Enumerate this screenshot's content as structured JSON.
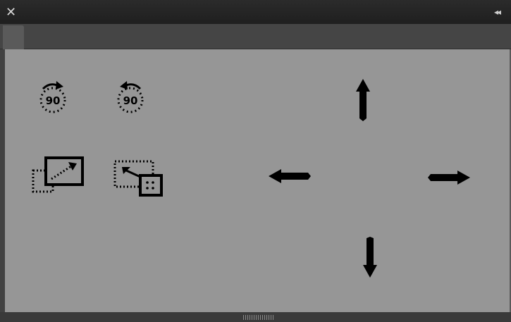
{
  "window": {
    "close_glyph": "✕",
    "collapse_glyph": "◂◂"
  },
  "tools": {
    "rotate_cw_label": "90",
    "rotate_ccw_label": "90"
  },
  "icons": {
    "rotate_cw": "rotate-clockwise-90-icon",
    "rotate_ccw": "rotate-counterclockwise-90-icon",
    "scale": "scale-icon",
    "reduce": "reduce-icon",
    "up": "arrow-up-icon",
    "down": "arrow-down-icon",
    "left": "arrow-left-icon",
    "right": "arrow-right-icon"
  },
  "colors": {
    "panel_bg": "#969696",
    "titlebar_bg": "#262626",
    "tabbar_bg": "#454545",
    "icon": "#000000"
  }
}
